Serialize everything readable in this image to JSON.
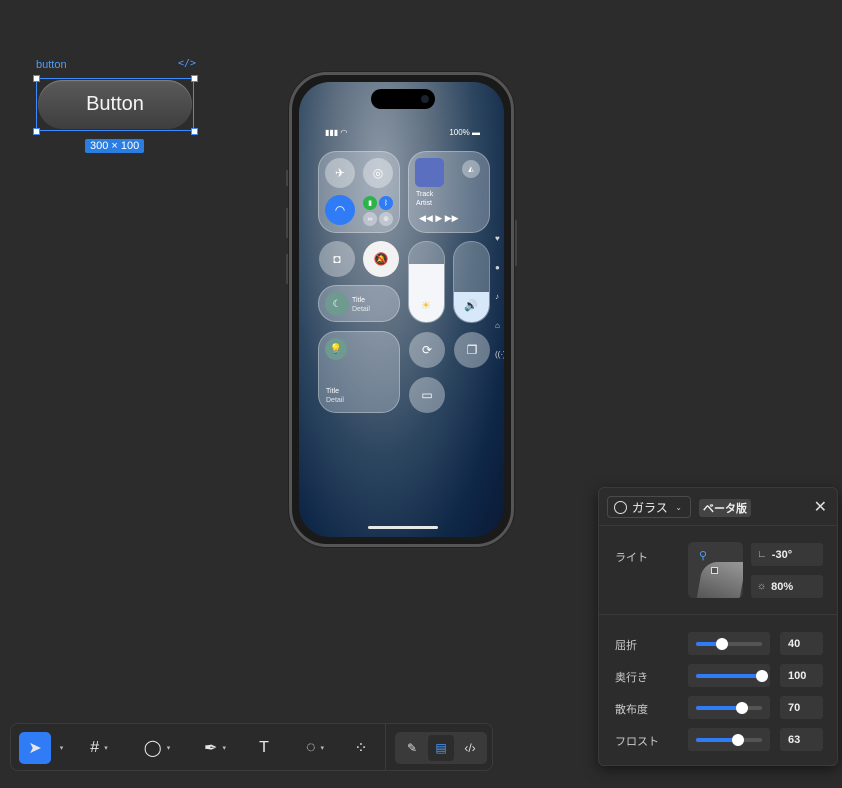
{
  "canvas": {
    "selected_layer_label": "button",
    "code_icon": "</>",
    "button_label": "Button",
    "size_badge": "300 × 100"
  },
  "phone": {
    "status_signal": "▮▮▮ ◠",
    "status_battery": "100% ▬",
    "media_track": "Track",
    "media_artist": "Artist",
    "media_controls": "◀◀   ▶   ▶▶",
    "focus_title": "Title",
    "focus_detail": "Detail",
    "big_tile_title": "Title",
    "big_tile_detail": "Detail",
    "brightness_level": 0.72,
    "volume_level": 0.38
  },
  "panel": {
    "material_label": "ガラス",
    "beta_badge": "ベータ版",
    "close_icon": "✕",
    "light_label": "ライト",
    "light_angle": "-30°",
    "light_intensity": "80%",
    "rows": [
      {
        "label": "屈折",
        "value": "40",
        "level": 0.4
      },
      {
        "label": "奥行き",
        "value": "100",
        "level": 1.0
      },
      {
        "label": "散布度",
        "value": "70",
        "level": 0.7
      },
      {
        "label": "フロスト",
        "value": "63",
        "level": 0.63
      }
    ]
  },
  "toolbar": {
    "tools": [
      "move-tool",
      "frame-tool",
      "ellipse-tool",
      "pen-tool",
      "text-tool",
      "comment-tool",
      "components-tool"
    ],
    "active_tool": "move-tool",
    "modes": [
      "draw-mode",
      "design-mode",
      "dev-mode"
    ],
    "active_mode": "design-mode"
  },
  "colors": {
    "accent": "#2f7cf6",
    "selection": "#3c8cff",
    "background": "#2c2c2c"
  }
}
